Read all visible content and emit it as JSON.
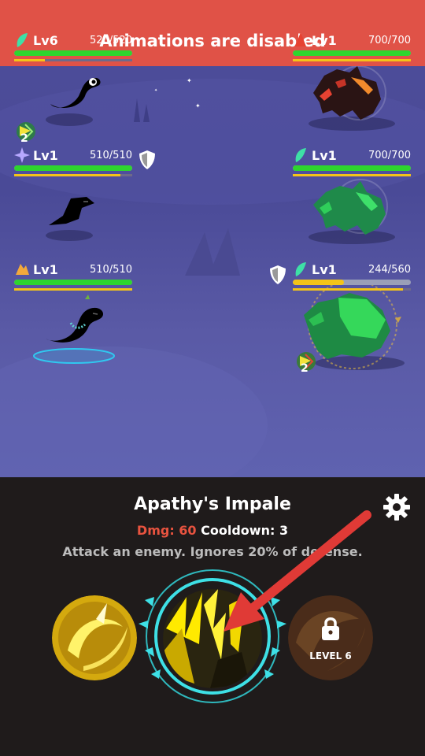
{
  "banner": {
    "text": "Animations are disabled"
  },
  "player_units": [
    {
      "level": "Lv6",
      "hp": "520/520",
      "hp_fraction": 1.0,
      "xp_fraction": 0.26,
      "element": "leaf",
      "buff_count": "2",
      "has_shield": false
    },
    {
      "level": "Lv1",
      "hp": "510/510",
      "hp_fraction": 1.0,
      "xp_fraction": 0.9,
      "element": "star",
      "has_shield": true
    },
    {
      "level": "Lv1",
      "hp": "510/510",
      "hp_fraction": 1.0,
      "xp_fraction": 1.0,
      "element": "crystal",
      "has_shield": false
    }
  ],
  "enemy_units": [
    {
      "level": "Lv1",
      "hp": "700/700",
      "hp_fraction": 1.0,
      "xp_fraction": 1.0,
      "element": "fire"
    },
    {
      "level": "Lv1",
      "hp": "700/700",
      "hp_fraction": 1.0,
      "xp_fraction": 1.0,
      "element": "leaf"
    },
    {
      "level": "Lv1",
      "hp": "244/560",
      "hp_fraction": 0.436,
      "xp_fraction": 0.93,
      "element": "leaf",
      "buff_count": "2",
      "has_shield": true
    }
  ],
  "skill": {
    "name": "Apathy's Impale",
    "dmg_label": "Dmg:",
    "dmg_value": "60",
    "cooldown_label": "Cooldown:",
    "cooldown_value": "3",
    "description": "Attack an enemy. Ignores 20% of defense."
  },
  "skill_slots": [
    {
      "name": "slot-1",
      "state": "available"
    },
    {
      "name": "slot-2",
      "state": "selected"
    },
    {
      "name": "slot-3",
      "state": "locked",
      "lock_text": "LEVEL 6"
    }
  ],
  "colors": {
    "hp_green": "#2ed52e",
    "hp_low": "#f4c418",
    "banner": "#e85242",
    "arrow": "#e03a36",
    "teal": "#3ee0e6"
  },
  "icons": [
    "settings-gear-icon",
    "shield-icon",
    "lock-icon",
    "leaf-element-icon",
    "fire-element-icon",
    "star-element-icon",
    "crystal-element-icon",
    "attack-buff-icon"
  ]
}
